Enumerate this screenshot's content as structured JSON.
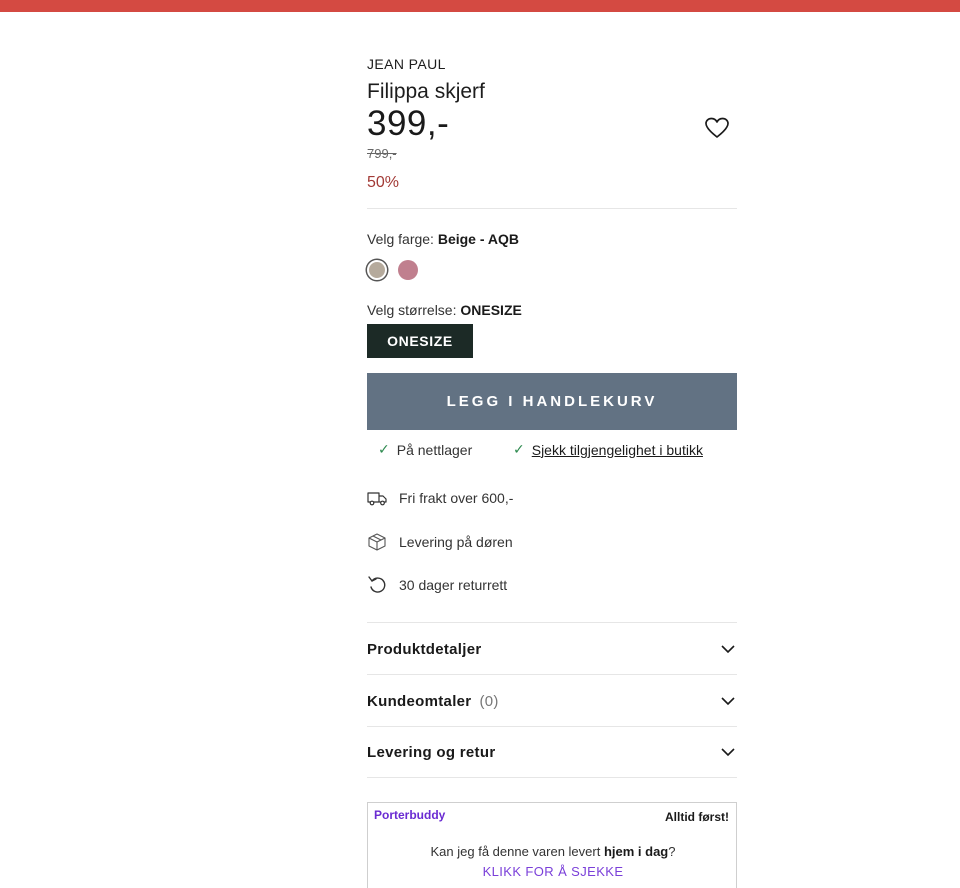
{
  "colors": {
    "topbar": "#d44a42",
    "discount": "#a23a36",
    "cart_button": "#627283",
    "size_selected": "#1c2a26",
    "check": "#2e8a4f",
    "porter": "#6a2bd2"
  },
  "product": {
    "brand": "JEAN PAUL",
    "name": "Filippa skjerf",
    "price": "399,-",
    "old_price": "799,-",
    "discount": "50%"
  },
  "color_select": {
    "label": "Velg farge: ",
    "selected": "Beige - AQB",
    "swatches": [
      {
        "name": "Beige - AQB",
        "color": "#b5aa9c",
        "selected": true
      },
      {
        "name": "Rosa",
        "color": "#c07f8e",
        "selected": false
      }
    ]
  },
  "size_select": {
    "label": "Velg størrelse: ",
    "selected": "ONESIZE",
    "options": [
      "ONESIZE"
    ]
  },
  "cart": {
    "button_label": "LEGG I HANDLEKURV"
  },
  "availability": {
    "online": "På nettlager",
    "store_link": "Sjekk tilgjengelighet i butikk"
  },
  "features": [
    {
      "icon": "truck-icon",
      "text": "Fri frakt over 600,-"
    },
    {
      "icon": "package-icon",
      "text": "Levering på døren"
    },
    {
      "icon": "return-icon",
      "text": "30 dager returrett"
    }
  ],
  "accordions": [
    {
      "title": "Produktdetaljer",
      "count": ""
    },
    {
      "title": "Kundeomtaler",
      "count": "(0)"
    },
    {
      "title": "Levering og retur",
      "count": ""
    }
  ],
  "porterbuddy": {
    "logo": "Porterbuddy",
    "tagline": "Alltid først!",
    "question_pre": "Kan jeg få denne varen levert ",
    "question_bold": "hjem i dag",
    "question_post": "?",
    "link": "KLIKK FOR Å SJEKKE"
  }
}
